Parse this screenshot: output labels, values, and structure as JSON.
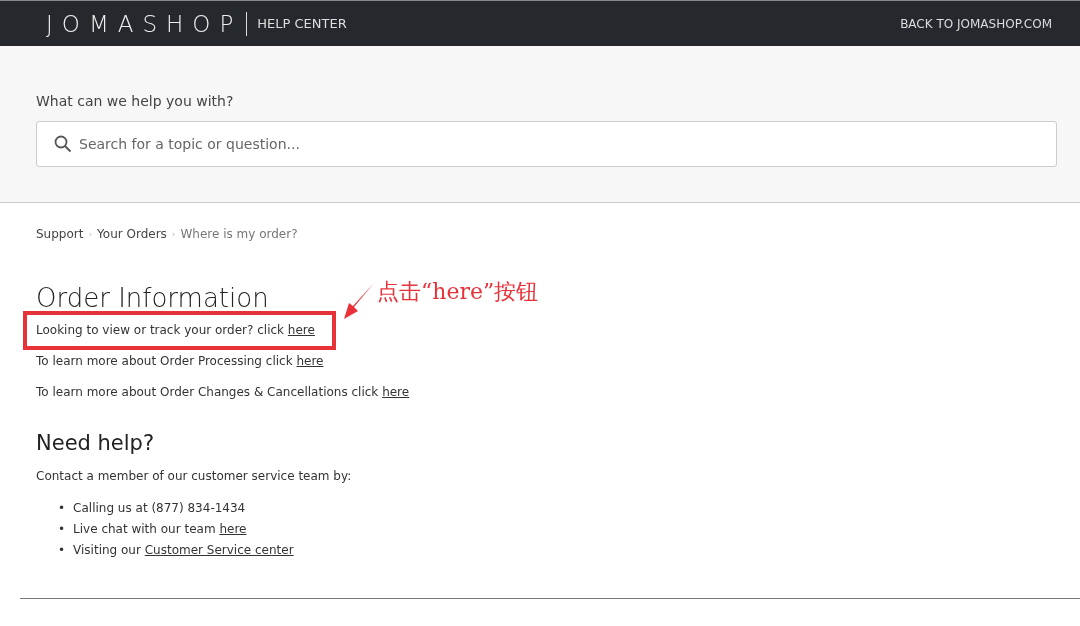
{
  "header": {
    "logo": "JOMASHOP",
    "section": "HELP CENTER",
    "back_link": "BACK TO JOMASHOP.COM"
  },
  "search": {
    "prompt": "What can we help you with?",
    "placeholder": "Search for a topic or question..."
  },
  "breadcrumb_separator": "›",
  "breadcrumb": [
    {
      "label": "Support",
      "current": false
    },
    {
      "label": "Your Orders",
      "current": false
    },
    {
      "label": "Where is my order?",
      "current": true
    }
  ],
  "article": {
    "title": "Order Information",
    "paragraphs": [
      {
        "text": "Looking to view or track your order? click",
        "link": "here",
        "highlighted": true
      },
      {
        "text": "To learn more about Order Processing click",
        "link": "here",
        "highlighted": false
      },
      {
        "text": "To learn more about Order Changes & Cancellations click",
        "link": "here",
        "highlighted": false
      }
    ],
    "annotation": "点击“here”按钮"
  },
  "help": {
    "title": "Need help?",
    "intro": "Contact a member of our customer service team by:",
    "items": [
      {
        "bullet": "•",
        "text": "Calling us at (877) 834-1434"
      },
      {
        "bullet": "•",
        "text": "Live chat with our team",
        "link": "here"
      },
      {
        "bullet": "•",
        "text": "Visiting our",
        "link": "Customer Service center"
      }
    ]
  }
}
